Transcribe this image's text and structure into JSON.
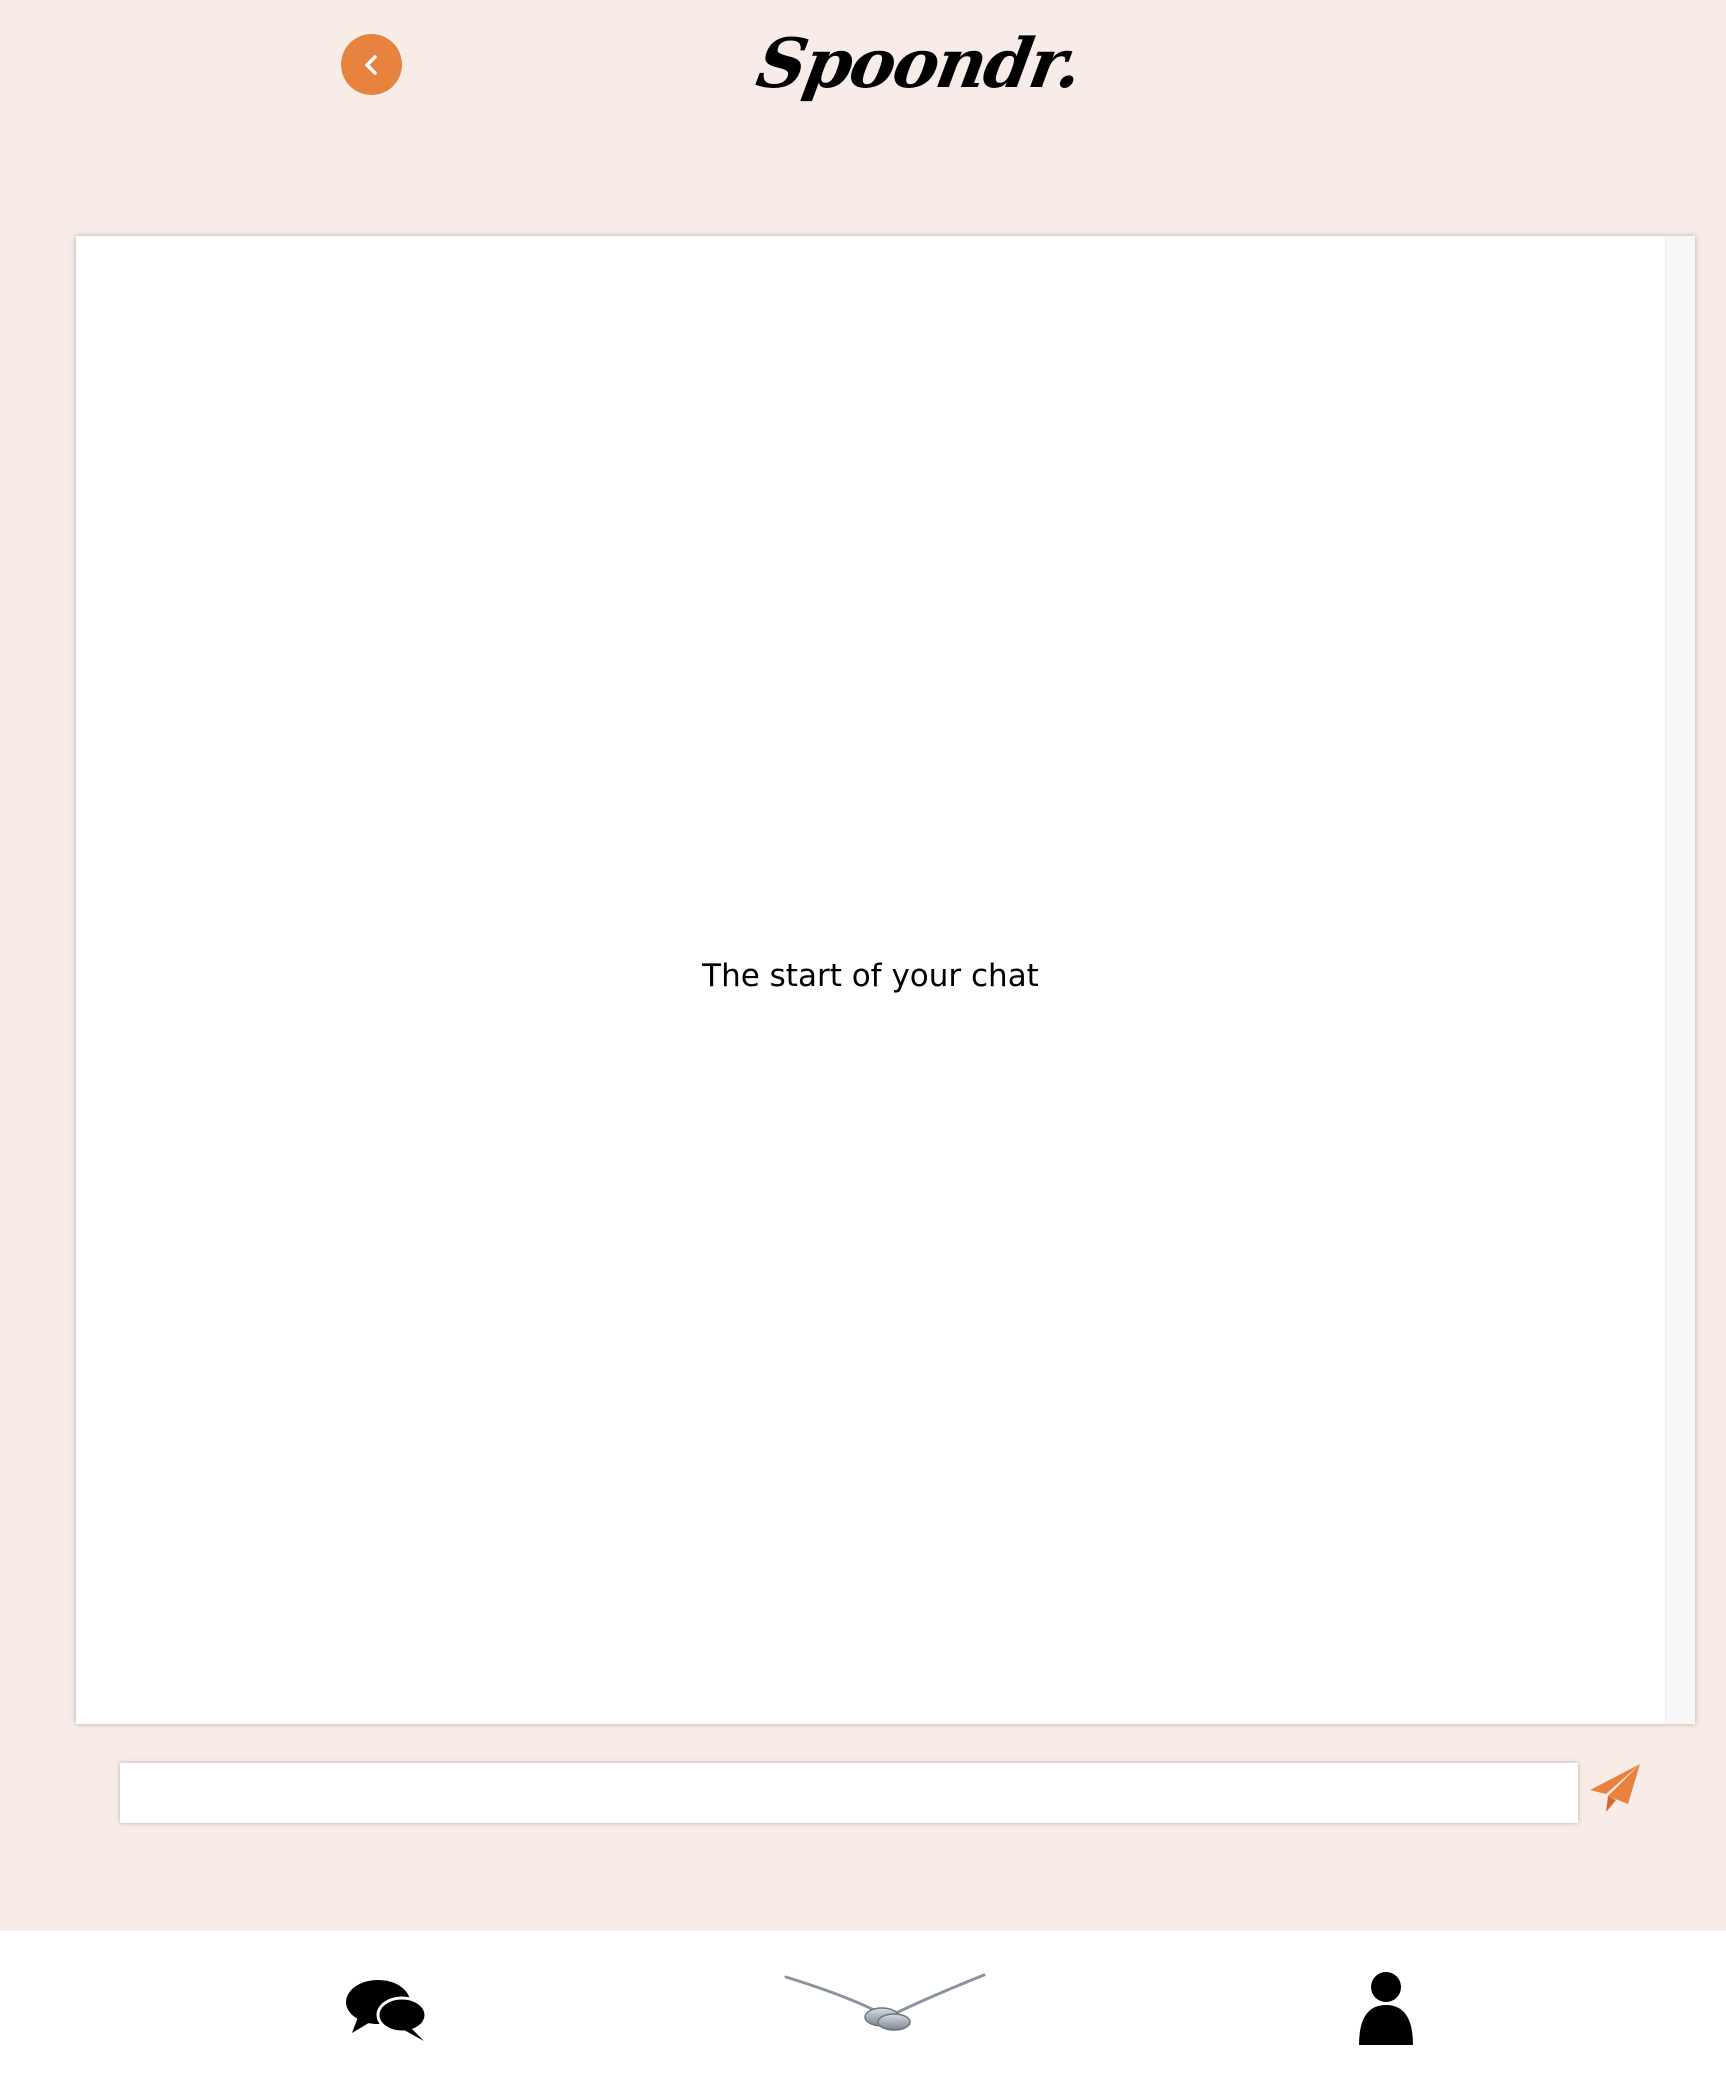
{
  "header": {
    "brand": "Spoondr.",
    "back_icon": "chevron-left-icon"
  },
  "chat": {
    "empty_text": "The start of your chat"
  },
  "composer": {
    "value": "",
    "placeholder": "",
    "send_icon": "paper-plane-icon"
  },
  "nav": {
    "items": [
      {
        "icon": "chat-bubbles-icon"
      },
      {
        "icon": "spoons-icon"
      },
      {
        "icon": "user-icon"
      }
    ]
  },
  "colors": {
    "accent": "#e8823f",
    "background": "#f7ece8",
    "card": "#ffffff"
  }
}
